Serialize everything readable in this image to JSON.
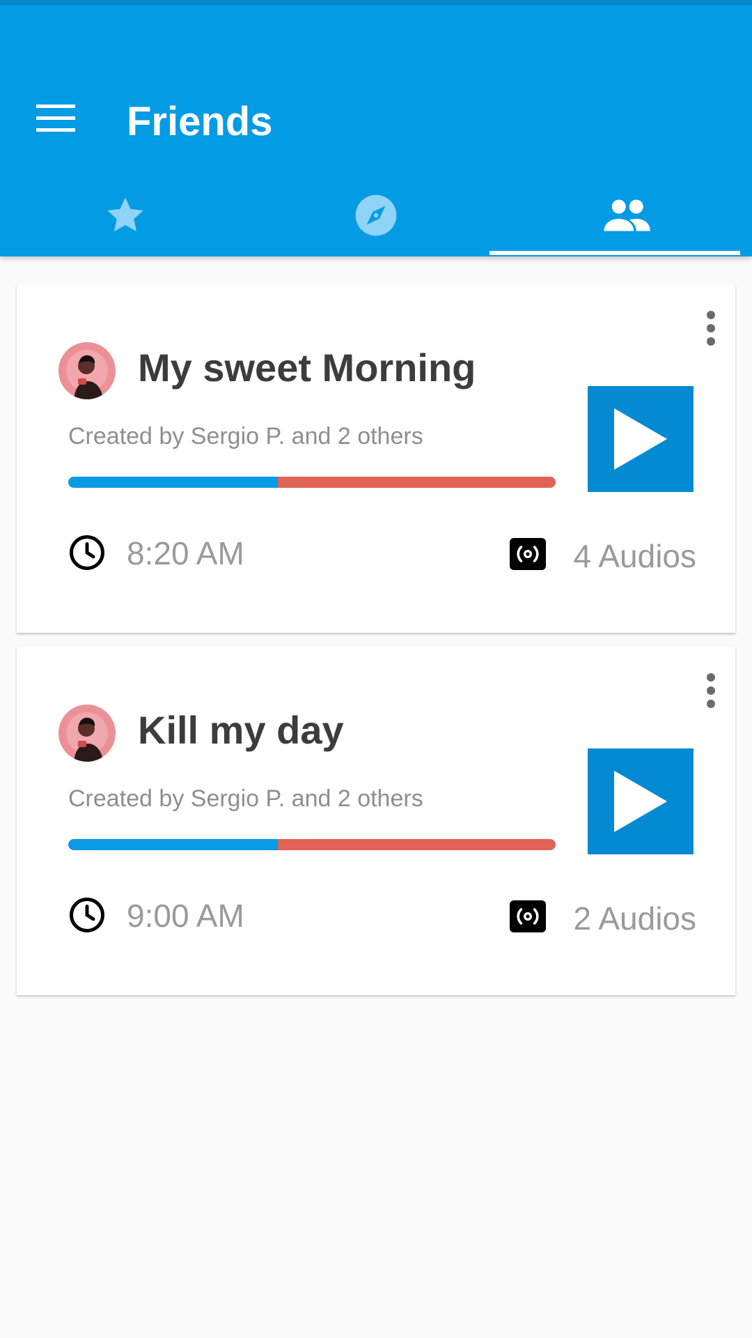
{
  "header": {
    "title": "Friends",
    "menu_icon": "hamburger-menu-icon",
    "background_color": "#049be5"
  },
  "tabs": [
    {
      "icon": "star-icon",
      "selected": false
    },
    {
      "icon": "compass-icon",
      "selected": false
    },
    {
      "icon": "people-icon",
      "selected": true
    }
  ],
  "cards": [
    {
      "title": "My sweet Morning",
      "subtitle": "Created by Sergio P. and 2 others",
      "time": "8:20 AM",
      "audios": "4 Audios",
      "progress": 0.43,
      "progress_colors": {
        "done": "#0a9be6",
        "rest": "#e06355"
      }
    },
    {
      "title": "Kill my day",
      "subtitle": "Created by Sergio P. and 2 others",
      "time": "9:00 AM",
      "audios": "2 Audios",
      "progress": 0.43,
      "progress_colors": {
        "done": "#0a9be6",
        "rest": "#e06355"
      }
    }
  ],
  "colors": {
    "accent": "#049be5",
    "play_button": "#048ad3",
    "background": "#fafafa"
  }
}
